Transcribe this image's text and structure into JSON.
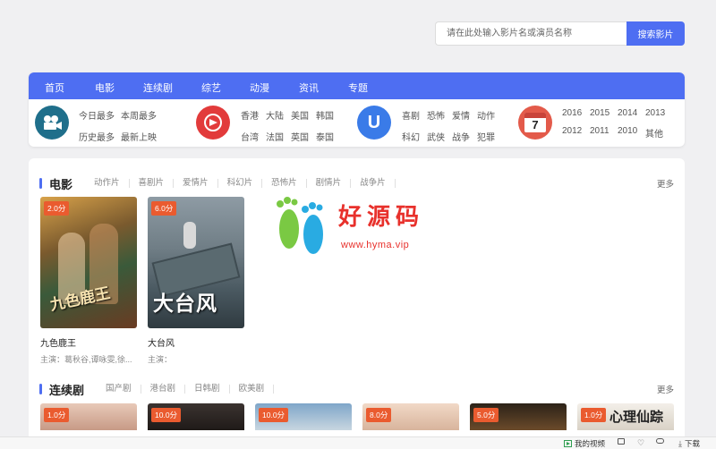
{
  "search": {
    "placeholder": "请在此处输入影片名或演员名称",
    "button": "搜索影片"
  },
  "nav": [
    "首页",
    "电影",
    "连续剧",
    "综艺",
    "动漫",
    "资讯",
    "专题"
  ],
  "cats": {
    "group1": [
      "今日最多",
      "本周最多",
      "历史最多",
      "最新上映"
    ],
    "group2": [
      "香港",
      "大陆",
      "美国",
      "韩国",
      "台湾",
      "法国",
      "英国",
      "泰国"
    ],
    "group3": [
      "喜剧",
      "恐怖",
      "爱情",
      "动作",
      "科幻",
      "武侠",
      "战争",
      "犯罪"
    ],
    "group4": [
      "2016",
      "2015",
      "2014",
      "2013",
      "2012",
      "2011",
      "2010",
      "其他"
    ],
    "calendar_day": "7"
  },
  "movies": {
    "title": "电影",
    "tabs": [
      "动作片",
      "喜剧片",
      "爱情片",
      "科幻片",
      "恐怖片",
      "剧情片",
      "战争片"
    ],
    "more": "更多",
    "items": [
      {
        "score": "2.0分",
        "title": "九色鹿王",
        "actors": "主演：葛秋谷,谭咏雯,徐...",
        "poster_text": "九色鹿王"
      },
      {
        "score": "6.0分",
        "title": "大台风",
        "actors": "主演：",
        "poster_text": "大台风"
      }
    ]
  },
  "series": {
    "title": "连续剧",
    "tabs": [
      "国产剧",
      "港台剧",
      "日韩剧",
      "欧美剧"
    ],
    "more": "更多",
    "scores": [
      "1.0分",
      "10.0分",
      "10.0分",
      "8.0分",
      "5.0分",
      "1.0分"
    ],
    "last_poster_text": "心理仙踪"
  },
  "watermark": {
    "text": "好源码",
    "url": "www.hyma.vip"
  },
  "bottombar": {
    "my_video": "我的视频",
    "download": "下载"
  },
  "colors": {
    "accent": "#4e6ef2",
    "score": "#ea5b2f",
    "watermark": "#e8312c"
  }
}
